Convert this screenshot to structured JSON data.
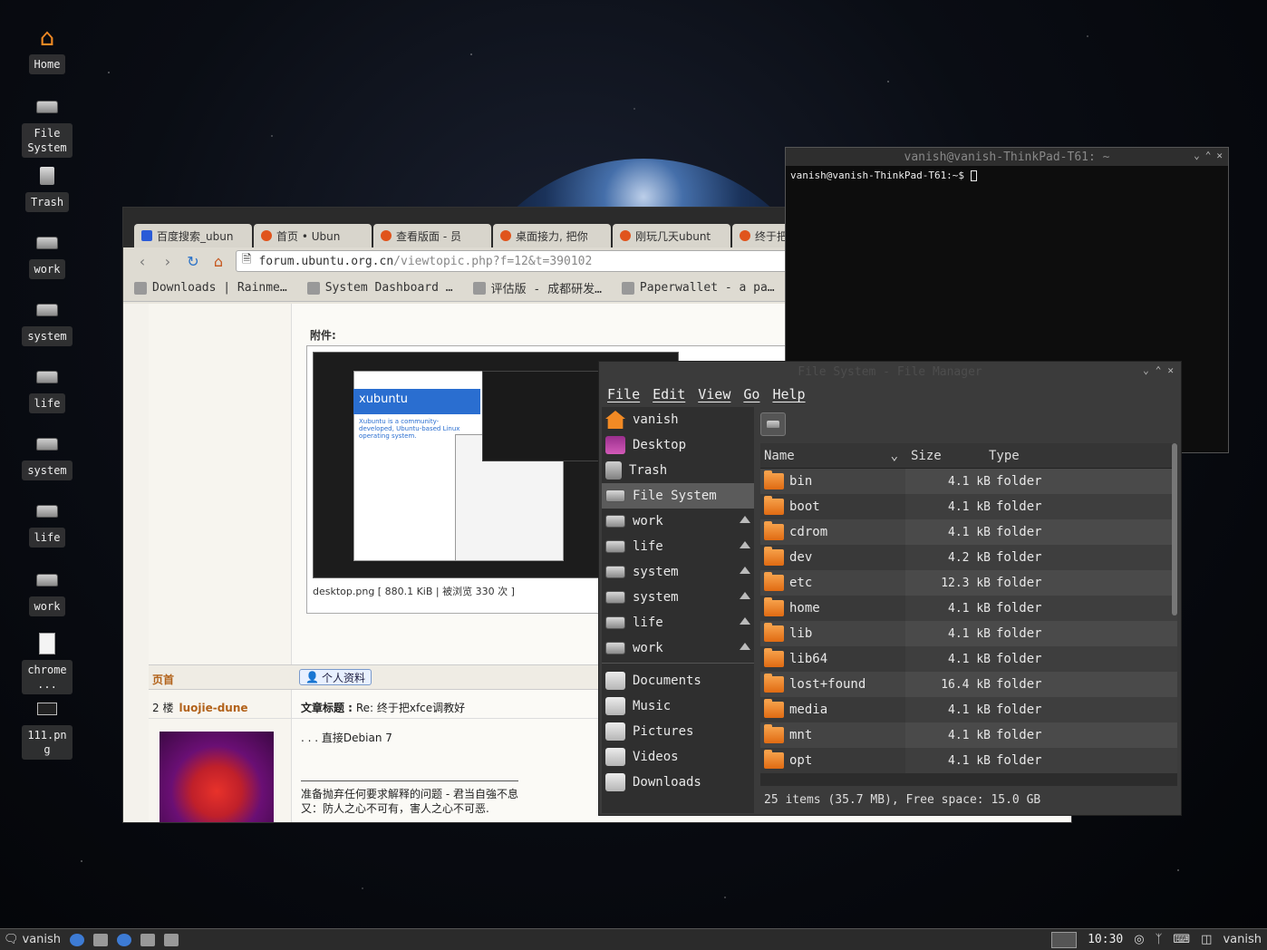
{
  "desktop": {
    "icons": [
      {
        "label": "Home",
        "icon": "home-icon"
      },
      {
        "label": "File System",
        "icon": "drive-icon"
      },
      {
        "label": "Trash",
        "icon": "trash-icon"
      },
      {
        "label": "work",
        "icon": "drive-icon"
      },
      {
        "label": "system",
        "icon": "drive-icon"
      },
      {
        "label": "life",
        "icon": "drive-icon"
      },
      {
        "label": "system",
        "icon": "drive-icon"
      },
      {
        "label": "life",
        "icon": "drive-icon"
      },
      {
        "label": "work",
        "icon": "drive-icon"
      },
      {
        "label": "chrome...",
        "icon": "document-icon"
      },
      {
        "label": "111.png",
        "icon": "image-icon"
      }
    ]
  },
  "browser": {
    "tabs": [
      "百度搜索_ubun",
      "首页 • Ubun",
      "查看版面 - 员",
      "桌面接力, 把你",
      "刚玩几天ubunt",
      "终于把"
    ],
    "url_host": "forum.ubuntu.org.cn",
    "url_path": "/viewtopic.php?f=12&t=390102",
    "bookmarks": [
      "Downloads | Rainme…",
      "System Dashboard …",
      "评估版 - 成都研发…",
      "Paperwallet - a pa…"
    ],
    "attachment_label": "附件:",
    "screenshot_heading": "xubuntu",
    "screenshot_text": "Xubuntu is a community-developed, Ubuntu-based Linux operating system.",
    "attachment_caption": "desktop.png [ 880.1 KiB | 被浏览 330 次 ]",
    "home_link": "页首",
    "profile_button": "个人资料",
    "post2_floor": "2 楼",
    "post2_author": "luojie-dune",
    "post2_subject_label": "文章标题 :",
    "post2_subject": "Re: 终于把xfce调教好",
    "post2_body": ". . .   直接Debian 7",
    "signature_line1": "准备抛弃任何要求解释的问题 - 君当自強不息",
    "signature_line2": "又：防人之心不可有，害人之心不可恶."
  },
  "terminal": {
    "title": "vanish@vanish-ThinkPad-T61: ~",
    "prompt": "vanish@vanish-ThinkPad-T61:~$ "
  },
  "file_manager": {
    "title": "File System - File Manager",
    "menu": [
      "File",
      "Edit",
      "View",
      "Go",
      "Help"
    ],
    "sidebar": [
      {
        "label": "vanish",
        "icon": "home",
        "eject": false
      },
      {
        "label": "Desktop",
        "icon": "desktop",
        "eject": false
      },
      {
        "label": "Trash",
        "icon": "trash",
        "eject": false
      },
      {
        "label": "File System",
        "icon": "drive",
        "eject": false,
        "active": true
      },
      {
        "label": "work",
        "icon": "drive",
        "eject": true
      },
      {
        "label": "life",
        "icon": "drive",
        "eject": true
      },
      {
        "label": "system",
        "icon": "drive",
        "eject": true
      },
      {
        "label": "system",
        "icon": "drive",
        "eject": true
      },
      {
        "label": "life",
        "icon": "drive",
        "eject": true
      },
      {
        "label": "work",
        "icon": "drive",
        "eject": true
      }
    ],
    "places": [
      {
        "label": "Documents"
      },
      {
        "label": "Music"
      },
      {
        "label": "Pictures"
      },
      {
        "label": "Videos"
      },
      {
        "label": "Downloads"
      }
    ],
    "columns": {
      "name": "Name",
      "size": "Size",
      "type": "Type"
    },
    "rows": [
      {
        "name": "bin",
        "size": "4.1 kB",
        "type": "folder"
      },
      {
        "name": "boot",
        "size": "4.1 kB",
        "type": "folder"
      },
      {
        "name": "cdrom",
        "size": "4.1 kB",
        "type": "folder"
      },
      {
        "name": "dev",
        "size": "4.2 kB",
        "type": "folder"
      },
      {
        "name": "etc",
        "size": "12.3 kB",
        "type": "folder"
      },
      {
        "name": "home",
        "size": "4.1 kB",
        "type": "folder"
      },
      {
        "name": "lib",
        "size": "4.1 kB",
        "type": "folder"
      },
      {
        "name": "lib64",
        "size": "4.1 kB",
        "type": "folder"
      },
      {
        "name": "lost+found",
        "size": "16.4 kB",
        "type": "folder"
      },
      {
        "name": "media",
        "size": "4.1 kB",
        "type": "folder"
      },
      {
        "name": "mnt",
        "size": "4.1 kB",
        "type": "folder"
      },
      {
        "name": "opt",
        "size": "4.1 kB",
        "type": "folder"
      }
    ],
    "status": "25 items (35.7 MB), Free space: 15.0 GB"
  },
  "taskbar": {
    "user": "vanish",
    "clock": "10:30",
    "user_right": "vanish"
  }
}
